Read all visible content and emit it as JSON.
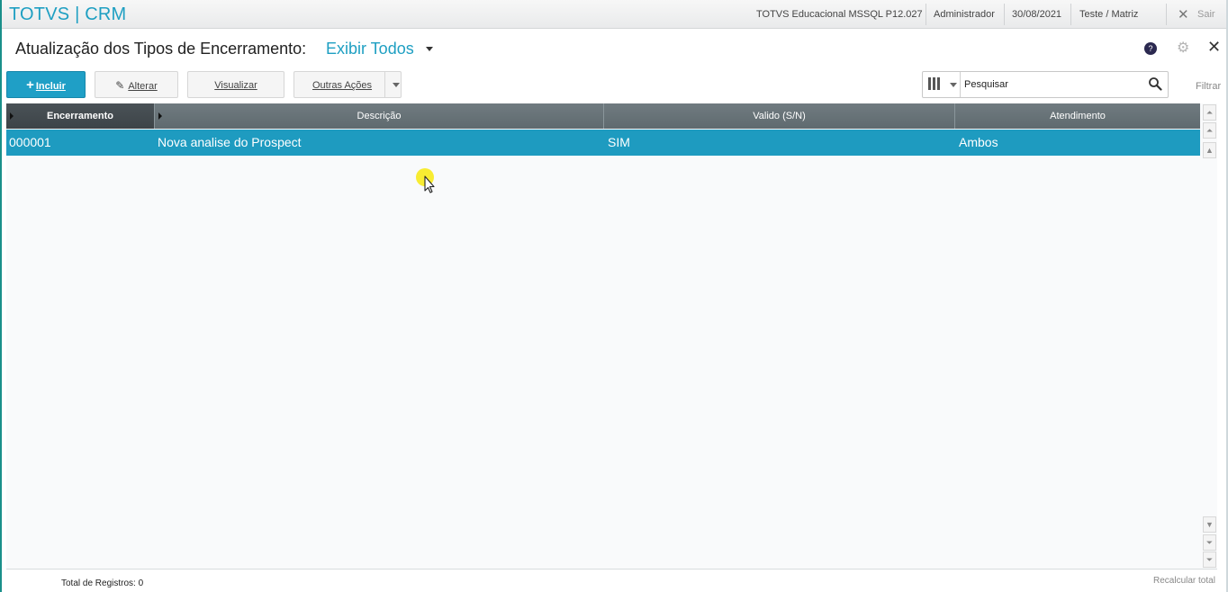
{
  "app": {
    "title": "TOTVS | CRM"
  },
  "topbar": {
    "environment": "TOTVS Educacional MSSQL P12.027",
    "user": "Administrador",
    "date": "30/08/2021",
    "branch": "Teste / Matriz",
    "exit_label": "Sair"
  },
  "header": {
    "title": "Atualização dos Tipos de Encerramento:",
    "view_selector": "Exibir Todos"
  },
  "toolbar": {
    "add_label": "Incluir",
    "edit_label": "Alterar",
    "view_label": "Visualizar",
    "more_label": "Outras Ações"
  },
  "search": {
    "placeholder": "Pesquisar",
    "filter_label": "Filtrar"
  },
  "grid": {
    "columns": [
      "Encerramento",
      "Descrição",
      "Valido (S/N)",
      "Atendimento"
    ],
    "rows": [
      [
        "000001",
        "Nova analise do Prospect",
        "SIM",
        "Ambos"
      ]
    ]
  },
  "footer": {
    "total_records": "Total de Registros: 0",
    "recalc_label": "Recalcular total"
  },
  "colors": {
    "accent": "#1e9fc2",
    "selected_row": "#1e9bc0",
    "grid_header": "#6a757a",
    "primary_button": "#1f9fc6"
  },
  "icons": [
    "plus-icon",
    "pencil-icon",
    "columns-icon",
    "search-icon",
    "help-icon",
    "gear-icon",
    "close-icon",
    "exit-icon",
    "chevron-down-icon",
    "mouse-cursor-icon"
  ]
}
